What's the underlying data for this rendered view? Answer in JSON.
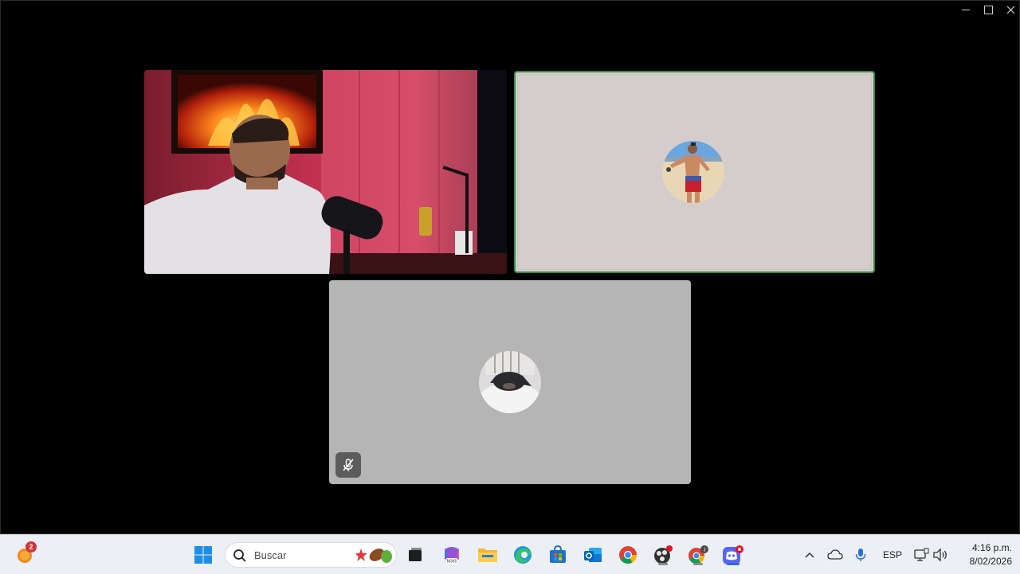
{
  "window": {
    "controls": [
      "minimize-icon",
      "maximize-icon",
      "close-icon"
    ]
  },
  "participants": [
    {
      "type": "video",
      "description_icon": "camera-video-feed"
    },
    {
      "type": "avatar",
      "speaking": true,
      "accent_color": "#2f8f46",
      "background": "#d5cdcc"
    },
    {
      "type": "avatar",
      "muted": true,
      "background": "#b6b5b6"
    }
  ],
  "taskbar": {
    "widgets_badge": "2",
    "search_placeholder": "Buscar",
    "pinned": [
      "task-view-icon",
      "m365-copilot-icon",
      "file-explorer-icon",
      "edge-icon",
      "microsoft-store-icon",
      "outlook-icon",
      "chrome-icon",
      "obs-icon",
      "chrome-profile-icon",
      "discord-icon"
    ],
    "tray": {
      "language": "ESP",
      "time": "4:16 p.m.",
      "date": "8/02/2026"
    }
  }
}
